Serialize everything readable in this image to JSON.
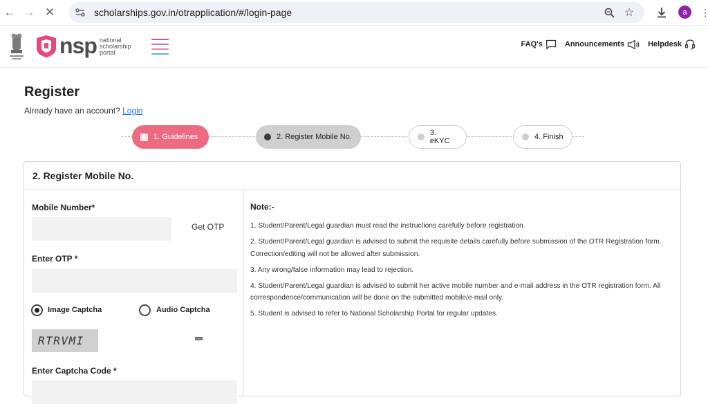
{
  "browser": {
    "url": "scholarships.gov.in/otrapplication/#/login-page",
    "profile_initial": "a"
  },
  "header": {
    "logo_letters": "nsp",
    "logo_sub": [
      "national",
      "scholarship",
      "portal"
    ],
    "links": [
      {
        "label": "FAQ's",
        "icon": "chat-icon"
      },
      {
        "label": "Announcements",
        "icon": "megaphone-icon"
      },
      {
        "label": "Helpdesk",
        "icon": "headset-icon"
      }
    ],
    "brand_color": "#e8497a"
  },
  "page": {
    "title": "Register",
    "account_prefix": "Already have an account?",
    "login_link": "Login"
  },
  "stepper": [
    {
      "label": "1. Guidelines",
      "state": "done"
    },
    {
      "label": "2. Register Mobile No.",
      "state": "active"
    },
    {
      "label": "3. eKYC",
      "state": "pending"
    },
    {
      "label": "4. Finish",
      "state": "pending"
    }
  ],
  "form": {
    "card_title": "2. Register Mobile No.",
    "mobile_label": "Mobile Number*",
    "mobile_value": "",
    "get_otp": "Get OTP",
    "otp_label": "Enter OTP *",
    "otp_value": "",
    "captcha_options": [
      {
        "label": "Image Captcha",
        "selected": true
      },
      {
        "label": "Audio Captcha",
        "selected": false
      }
    ],
    "captcha_text": "RTRVMI",
    "captcha_code_label": "Enter Captcha Code *",
    "captcha_code_value": ""
  },
  "notes": {
    "title": "Note:-",
    "items": [
      "1. Student/Parent/Legal guardian must read the instructions carefully before registration.",
      "2. Student/Parent/Legal guardian is advised to submit the requisite details carefully before submission of the OTR Registration form. Correction/editing will not be allowed after submission.",
      "3. Any wrong/false information may lead to rejection.",
      "4. Student/Parent/Legal guardian is advised to submit her active mobile number and e-mail address in the OTR registration form. All correspondence/communication will be done on the submitted mobile/e-mail only.",
      "5. Student is advised to refer to National Scholarship Portal for regular updates."
    ]
  }
}
